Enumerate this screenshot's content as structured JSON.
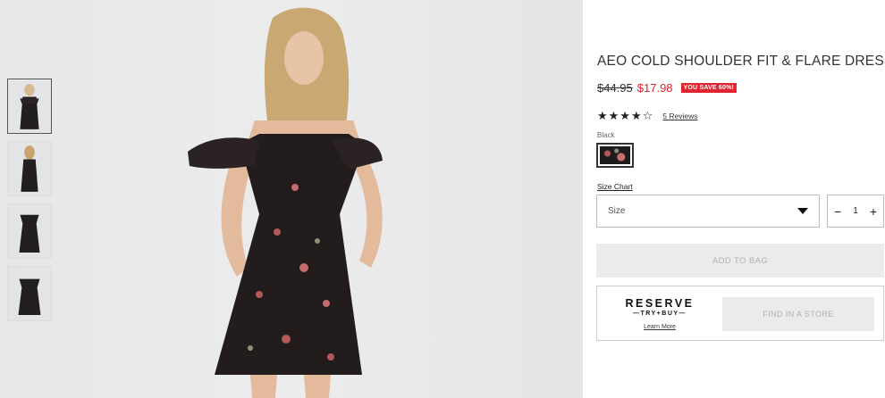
{
  "product": {
    "title": "AEO COLD SHOULDER FIT & FLARE DRESS",
    "old_price": "$44.95",
    "new_price": "$17.98",
    "save_badge": "YOU SAVE 60%!",
    "rating_stars": "★★★★☆",
    "rating_value": 4,
    "reviews_label": "5 Reviews",
    "color_label": "Black",
    "size_chart_label": "Size Chart",
    "size_placeholder": "Size",
    "quantity": "1",
    "qty_minus": "−",
    "qty_plus": "+",
    "add_to_bag_label": "ADD TO BAG"
  },
  "reserve": {
    "title": "RESERVE",
    "subtitle": "—TRY+BUY—",
    "learn_more": "Learn More",
    "find_store_label": "FIND IN A STORE"
  },
  "gallery": {
    "thumbnail_count": 4,
    "active_index": 0
  },
  "colors": {
    "sale_red": "#e1242f",
    "disabled_bg": "#ebebeb",
    "disabled_text": "#b0b0b0"
  }
}
